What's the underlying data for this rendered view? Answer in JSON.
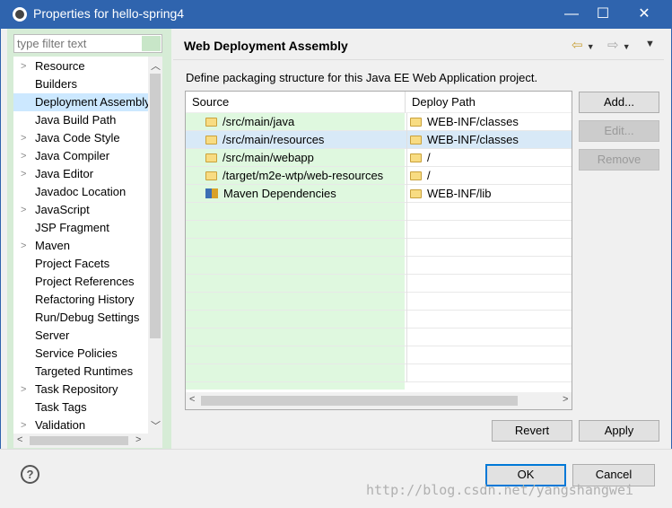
{
  "window": {
    "title": "Properties for hello-spring4",
    "minimize": "—",
    "maximize": "☐",
    "close": "✕"
  },
  "sidebar": {
    "filter_placeholder": "type filter text",
    "items": [
      {
        "label": "Resource",
        "expandable": true
      },
      {
        "label": "Builders"
      },
      {
        "label": "Deployment Assembly",
        "selected": true
      },
      {
        "label": "Java Build Path"
      },
      {
        "label": "Java Code Style",
        "expandable": true
      },
      {
        "label": "Java Compiler",
        "expandable": true
      },
      {
        "label": "Java Editor",
        "expandable": true
      },
      {
        "label": "Javadoc Location"
      },
      {
        "label": "JavaScript",
        "expandable": true
      },
      {
        "label": "JSP Fragment"
      },
      {
        "label": "Maven",
        "expandable": true
      },
      {
        "label": "Project Facets"
      },
      {
        "label": "Project References"
      },
      {
        "label": "Refactoring History"
      },
      {
        "label": "Run/Debug Settings"
      },
      {
        "label": "Server"
      },
      {
        "label": "Service Policies"
      },
      {
        "label": "Targeted Runtimes"
      },
      {
        "label": "Task Repository",
        "expandable": true
      },
      {
        "label": "Task Tags"
      },
      {
        "label": "Validation",
        "expandable": true
      }
    ]
  },
  "page": {
    "title": "Web Deployment Assembly",
    "description": "Define packaging structure for this Java EE Web Application project.",
    "columns": [
      "Source",
      "Deploy Path"
    ],
    "rows": [
      {
        "source": "/src/main/java",
        "icon": "folder-icon",
        "deploy": "WEB-INF/classes"
      },
      {
        "source": "/src/main/resources",
        "icon": "folder-icon",
        "deploy": "WEB-INF/classes",
        "selected": true
      },
      {
        "source": "/src/main/webapp",
        "icon": "folder-icon",
        "deploy": "/"
      },
      {
        "source": "/target/m2e-wtp/web-resources",
        "icon": "folder-icon",
        "deploy": "/"
      },
      {
        "source": "Maven Dependencies",
        "icon": "library-icon",
        "deploy": "WEB-INF/lib"
      }
    ],
    "add": "Add...",
    "edit": "Edit...",
    "remove": "Remove",
    "revert": "Revert",
    "apply": "Apply"
  },
  "footer": {
    "help": "?",
    "ok": "OK",
    "cancel": "Cancel",
    "watermark": "http://blog.csdn.net/yangshangwei"
  }
}
